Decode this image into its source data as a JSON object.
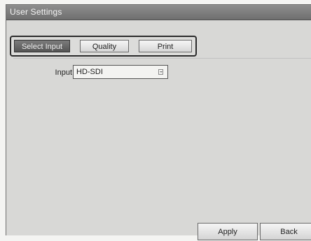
{
  "window": {
    "title": "User Settings"
  },
  "tabs": [
    {
      "label": "Select Input",
      "active": true
    },
    {
      "label": "Quality",
      "active": false
    },
    {
      "label": "Print",
      "active": false
    }
  ],
  "input_field": {
    "label": "Input",
    "value": "HD-SDI"
  },
  "buttons": {
    "apply": "Apply",
    "back": "Back"
  },
  "colors": {
    "title_bar": "#7a7a7a",
    "active_tab": "#5f5f5f",
    "panel": "#d8d8d6"
  },
  "icons": {
    "dropdown": "dropdown-arrow-icon"
  }
}
